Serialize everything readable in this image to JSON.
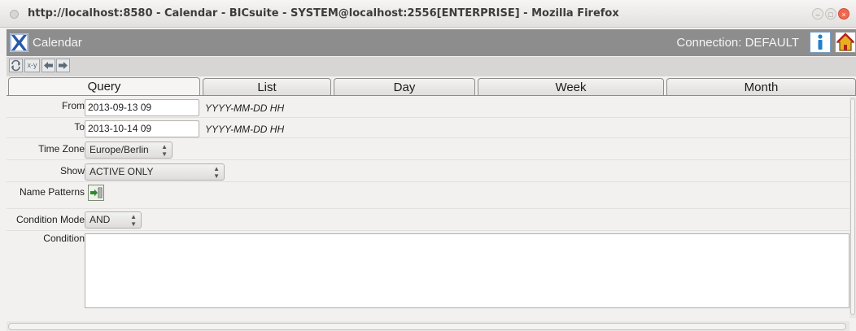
{
  "window": {
    "title": "http://localhost:8580 - Calendar - BICsuite - SYSTEM@localhost:2556[ENTERPRISE] - Mozilla Firefox"
  },
  "app": {
    "title": "Calendar",
    "connection": "Connection: DEFAULT",
    "icons": [
      "calendar-logo-icon",
      "info-icon",
      "home-icon"
    ]
  },
  "toolbar": {
    "buttons": [
      "refresh-icon",
      "xy-icon",
      "back-arrow-icon",
      "forward-arrow-icon"
    ],
    "xy_label": "x-y"
  },
  "tabs": {
    "query": "Query",
    "list": "List",
    "day": "Day",
    "week": "Week",
    "month": "Month"
  },
  "form": {
    "from_label": "From",
    "from_value": "2013-09-13 09",
    "from_hint": "YYYY-MM-DD HH",
    "to_label": "To",
    "to_value": "2013-10-14 09",
    "to_hint": "YYYY-MM-DD HH",
    "timezone_label": "Time Zone",
    "timezone_value": "Europe/Berlin",
    "show_label": "Show",
    "show_value": "ACTIVE ONLY",
    "name_patterns_label": "Name Patterns",
    "condition_mode_label": "Condition Mode",
    "condition_mode_value": "AND",
    "condition_label": "Condition",
    "condition_value": ""
  },
  "colors": {
    "app_header": "#8d8d8d",
    "close_button": "#f0674f",
    "info_blue": "#1f7fd1",
    "home_red": "#b52020"
  }
}
